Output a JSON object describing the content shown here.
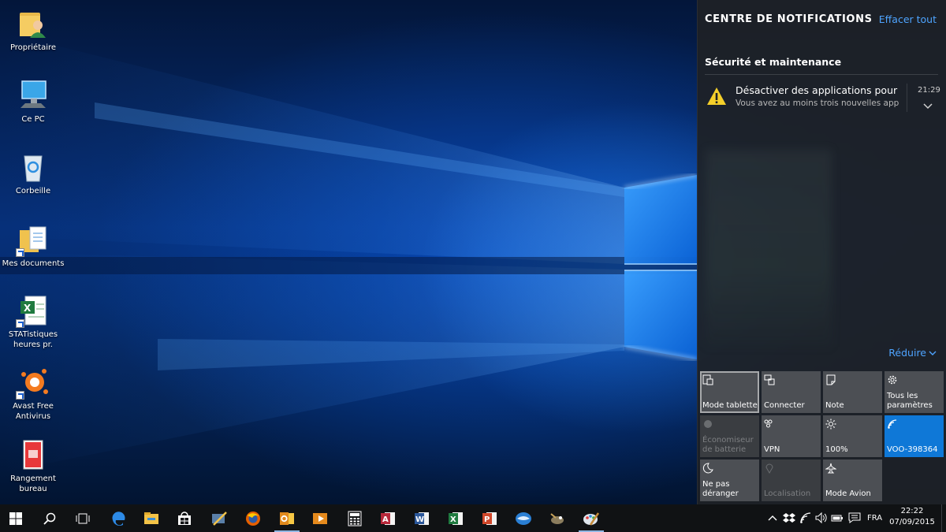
{
  "desktop": {
    "icons": [
      {
        "label": "Propriétaire",
        "icon": "user-folder-icon"
      },
      {
        "label": "Ce PC",
        "icon": "computer-icon"
      },
      {
        "label": "Corbeille",
        "icon": "recycle-bin-icon"
      },
      {
        "label": "Mes documents",
        "icon": "documents-folder-icon"
      },
      {
        "label": "STATistiques heures pr.",
        "icon": "excel-file-icon"
      },
      {
        "label": "Avast Free Antivirus",
        "icon": "avast-icon"
      },
      {
        "label": "Rangement bureau",
        "icon": "folder-red-icon"
      }
    ]
  },
  "action_center": {
    "title": "CENTRE DE NOTIFICATIONS",
    "clear_all": "Effacer tout",
    "group_title": "Sécurité et maintenance",
    "notification": {
      "title": "Désactiver des applications pour am",
      "body": "Vous avez au moins trois nouvelles applic",
      "time": "21:29"
    },
    "collapse_label": "Réduire",
    "tiles": [
      {
        "label": "Mode tablette",
        "icon": "tablet-mode-icon",
        "state": "selected"
      },
      {
        "label": "Connecter",
        "icon": "connect-icon",
        "state": "normal"
      },
      {
        "label": "Note",
        "icon": "note-icon",
        "state": "normal"
      },
      {
        "label": "Tous les paramètres",
        "icon": "gear-icon",
        "state": "normal"
      },
      {
        "label": "Économiseur de batterie",
        "icon": "battery-saver-icon",
        "state": "disabled"
      },
      {
        "label": "VPN",
        "icon": "vpn-icon",
        "state": "normal"
      },
      {
        "label": "100%",
        "icon": "brightness-icon",
        "state": "normal"
      },
      {
        "label": "VOO-398364",
        "icon": "wifi-icon",
        "state": "active"
      },
      {
        "label": "Ne pas déranger",
        "icon": "moon-icon",
        "state": "normal"
      },
      {
        "label": "Localisation",
        "icon": "location-icon",
        "state": "disabled"
      },
      {
        "label": "Mode Avion",
        "icon": "airplane-icon",
        "state": "normal"
      }
    ],
    "colors": {
      "accent": "#0f78d7",
      "link": "#4ea4ff",
      "panel": "#1e2126",
      "tile": "#4c4f54"
    }
  },
  "taskbar": {
    "pinned": [
      "start-icon",
      "search-icon",
      "task-view-icon",
      "edge-icon",
      "file-explorer-icon",
      "store-icon",
      "paint-brush-app-icon",
      "firefox-icon",
      "outlook-icon",
      "media-player-icon",
      "calculator-icon",
      "access-icon",
      "word-icon",
      "excel-icon",
      "powerpoint-icon",
      "thunderbird-icon",
      "gimp-icon",
      "paint-icon"
    ],
    "tray": {
      "language": "FRA",
      "time": "22:22",
      "date": "07/09/2015"
    }
  }
}
